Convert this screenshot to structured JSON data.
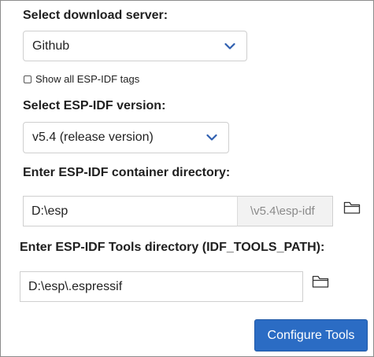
{
  "download_server": {
    "label": "Select download server:",
    "selected": "Github"
  },
  "show_all_tags": {
    "label": "Show all ESP-IDF tags",
    "checked": false
  },
  "idf_version": {
    "label": "Select ESP-IDF version:",
    "selected": "v5.4 (release version)"
  },
  "container_dir": {
    "label": "Enter ESP-IDF container directory:",
    "value": "D:\\esp",
    "suffix": "\\v5.4\\esp-idf"
  },
  "tools_dir": {
    "label": "Enter ESP-IDF Tools directory (IDF_TOOLS_PATH):",
    "value": "D:\\esp\\.espressif"
  },
  "configure_button": {
    "label": "Configure Tools"
  },
  "colors": {
    "accent": "#2b6cc4",
    "chevron": "#2f5fb0"
  },
  "icons": {
    "dropdown": "chevron-down-icon",
    "browse": "folder-icon"
  }
}
